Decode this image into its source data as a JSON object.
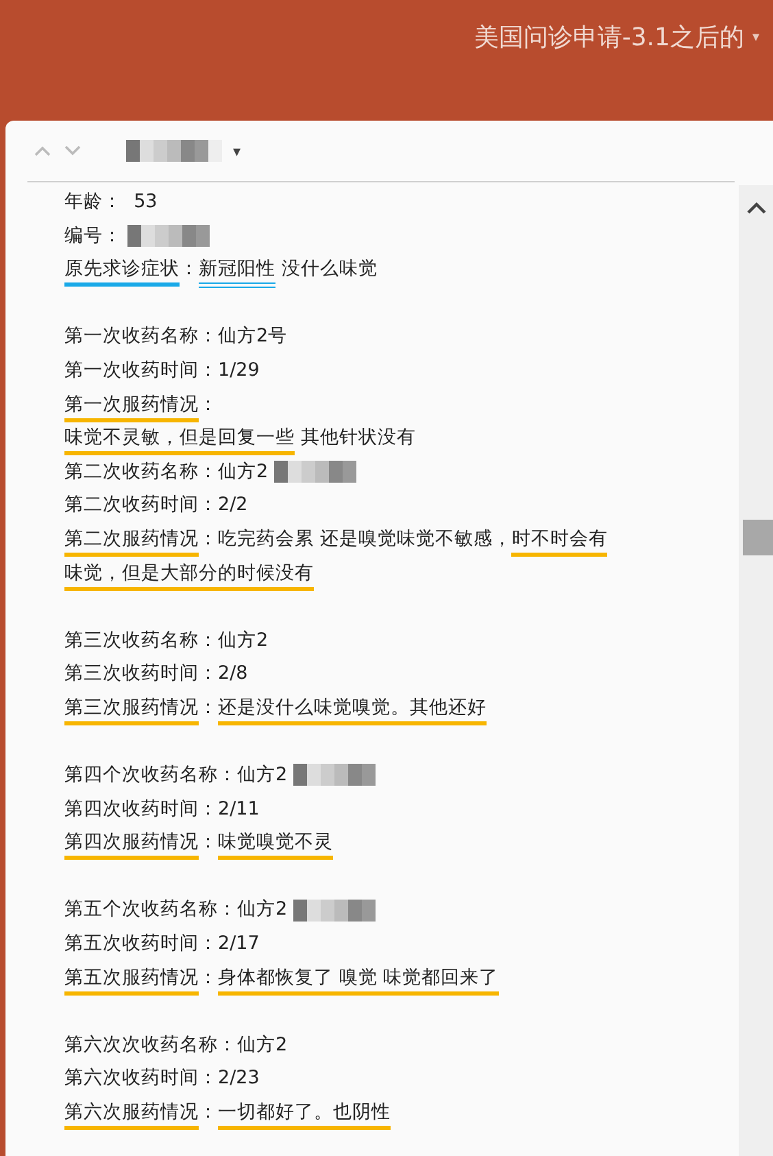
{
  "header": {
    "title": "美国问诊申请-3.1之后的",
    "caret": "▾"
  },
  "toolbar": {
    "name_redacted": true,
    "caret": "▾"
  },
  "lines": [
    {
      "kind": "text",
      "segments": [
        {
          "text": "年龄：  53",
          "underlined": false
        }
      ]
    },
    {
      "kind": "text",
      "redacted": true,
      "segments": [
        {
          "text": "编号：",
          "underlined": false
        }
      ]
    },
    {
      "kind": "text",
      "segments": [
        {
          "text": "原先求诊症状",
          "underlined": true,
          "color": "#19a9e8"
        },
        {
          "text": "：",
          "underlined": false
        },
        {
          "text": "新冠阳性",
          "underlined": true,
          "double": true,
          "color": "#19a9e8"
        },
        {
          "text": " 没什么味觉",
          "underlined": false
        }
      ]
    },
    {
      "kind": "gap"
    },
    {
      "kind": "text",
      "segments": [
        {
          "text": "第一次收药名称：仙方2号",
          "underlined": false
        }
      ]
    },
    {
      "kind": "text",
      "segments": [
        {
          "text": "第一次收药时间：1/29",
          "underlined": false
        }
      ]
    },
    {
      "kind": "text",
      "segments": [
        {
          "text": "第一次服药情况",
          "underlined": true,
          "color": "#f7b500"
        },
        {
          "text": "：",
          "underlined": false
        }
      ]
    },
    {
      "kind": "text",
      "segments": [
        {
          "text": "味觉不灵敏，但是回复一些",
          "underlined": true,
          "color": "#f7b500"
        },
        {
          "text": " 其他针状没有",
          "underlined": false
        }
      ]
    },
    {
      "kind": "text",
      "redacted": true,
      "segments": [
        {
          "text": "第二次收药名称：仙方2",
          "underlined": false
        }
      ]
    },
    {
      "kind": "text",
      "segments": [
        {
          "text": "第二次收药时间：2/2",
          "underlined": false
        }
      ]
    },
    {
      "kind": "text",
      "segments": [
        {
          "text": "第二次服药情况",
          "underlined": true,
          "color": "#f7b500"
        },
        {
          "text": "：吃完药会累 还是嗅觉味觉不敏感，",
          "underlined": false
        },
        {
          "text": "时不时会有味觉，但是大部分的时候没有",
          "underlined": true,
          "color": "#f7b500"
        }
      ]
    },
    {
      "kind": "gap"
    },
    {
      "kind": "text",
      "segments": [
        {
          "text": "第三次收药名称：仙方2",
          "underlined": false
        }
      ]
    },
    {
      "kind": "text",
      "segments": [
        {
          "text": "第三次收药时间：2/8",
          "underlined": false
        }
      ]
    },
    {
      "kind": "text",
      "segments": [
        {
          "text": "第三次服药情况",
          "underlined": true,
          "color": "#f7b500"
        },
        {
          "text": "：",
          "underlined": false
        },
        {
          "text": "还是没什么味觉嗅觉。其他还好",
          "underlined": true,
          "color": "#f7b500"
        }
      ]
    },
    {
      "kind": "gap"
    },
    {
      "kind": "text",
      "redacted": true,
      "segments": [
        {
          "text": "第四个次收药名称：仙方2",
          "underlined": false
        }
      ]
    },
    {
      "kind": "text",
      "segments": [
        {
          "text": "第四次收药时间：2/11",
          "underlined": false
        }
      ]
    },
    {
      "kind": "text",
      "segments": [
        {
          "text": "第四次服药情况",
          "underlined": true,
          "color": "#f7b500"
        },
        {
          "text": "：",
          "underlined": false
        },
        {
          "text": "味觉嗅觉不灵",
          "underlined": true,
          "color": "#f7b500"
        }
      ]
    },
    {
      "kind": "gap"
    },
    {
      "kind": "text",
      "redacted": true,
      "segments": [
        {
          "text": "第五个次收药名称：仙方2",
          "underlined": false
        }
      ]
    },
    {
      "kind": "text",
      "segments": [
        {
          "text": "第五次收药时间：2/17",
          "underlined": false
        }
      ]
    },
    {
      "kind": "text",
      "segments": [
        {
          "text": "第五次服药情况",
          "underlined": true,
          "color": "#f7b500"
        },
        {
          "text": "：",
          "underlined": false
        },
        {
          "text": "身体都恢复了 嗅觉 味觉都回来了",
          "underlined": true,
          "color": "#f7b500"
        }
      ]
    },
    {
      "kind": "gap"
    },
    {
      "kind": "text",
      "segments": [
        {
          "text": "第六次次收药名称：仙方2",
          "underlined": false
        }
      ]
    },
    {
      "kind": "text",
      "segments": [
        {
          "text": "第六次收药时间：2/23",
          "underlined": false
        }
      ]
    },
    {
      "kind": "text",
      "segments": [
        {
          "text": "第六次服药情况",
          "underlined": true,
          "color": "#f7b500"
        },
        {
          "text": "：",
          "underlined": false
        },
        {
          "text": "一切都好了。也阴性",
          "underlined": true,
          "color": "#f7b500"
        }
      ]
    }
  ]
}
